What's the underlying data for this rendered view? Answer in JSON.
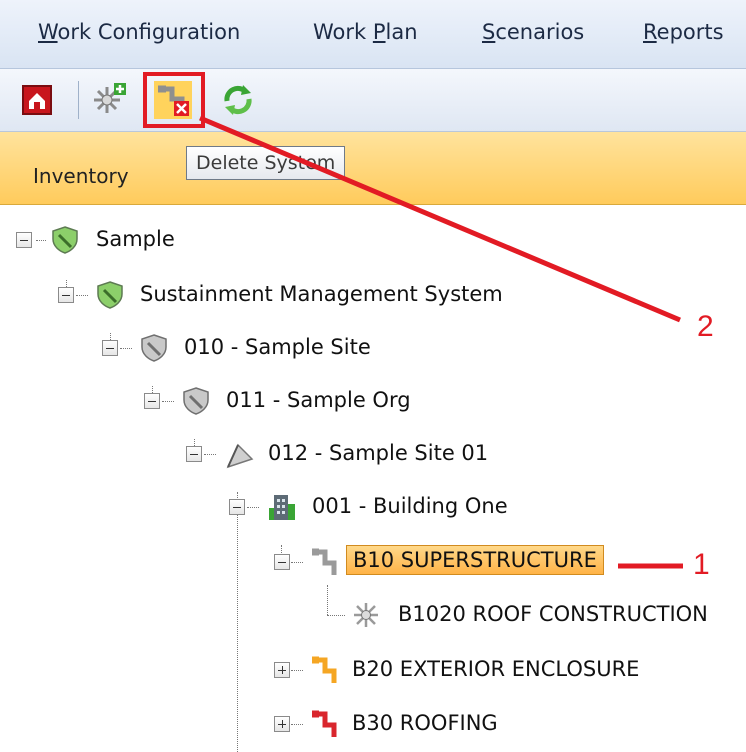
{
  "menu": {
    "items": [
      {
        "pre": "",
        "u": "W",
        "post": "ork Configuration"
      },
      {
        "pre": "Work ",
        "u": "P",
        "post": "lan"
      },
      {
        "pre": "",
        "u": "S",
        "post": "cenarios"
      },
      {
        "pre": "",
        "u": "R",
        "post": "eports"
      }
    ]
  },
  "toolbar": {
    "buttons": [
      "home-icon",
      "add-system-icon",
      "delete-system-icon",
      "refresh-icon"
    ]
  },
  "tab": {
    "label": "Inventory"
  },
  "tooltip": {
    "text": "Delete System"
  },
  "tree": {
    "nodes": [
      {
        "label": "Sample"
      },
      {
        "label": "Sustainment Management System"
      },
      {
        "label": "010 - Sample Site"
      },
      {
        "label": "011 - Sample Org"
      },
      {
        "label": "012 - Sample Site 01"
      },
      {
        "label": "001 - Building One"
      },
      {
        "label": "B10 SUPERSTRUCTURE"
      },
      {
        "label": "B1020 ROOF CONSTRUCTION"
      },
      {
        "label": "B20 EXTERIOR ENCLOSURE"
      },
      {
        "label": "B30 ROOFING"
      }
    ]
  },
  "annotations": {
    "one": "1",
    "two": "2"
  },
  "colors": {
    "callout": "#e21b24",
    "selection": "#ffb347",
    "tabstrip": "#ffcb5c"
  }
}
